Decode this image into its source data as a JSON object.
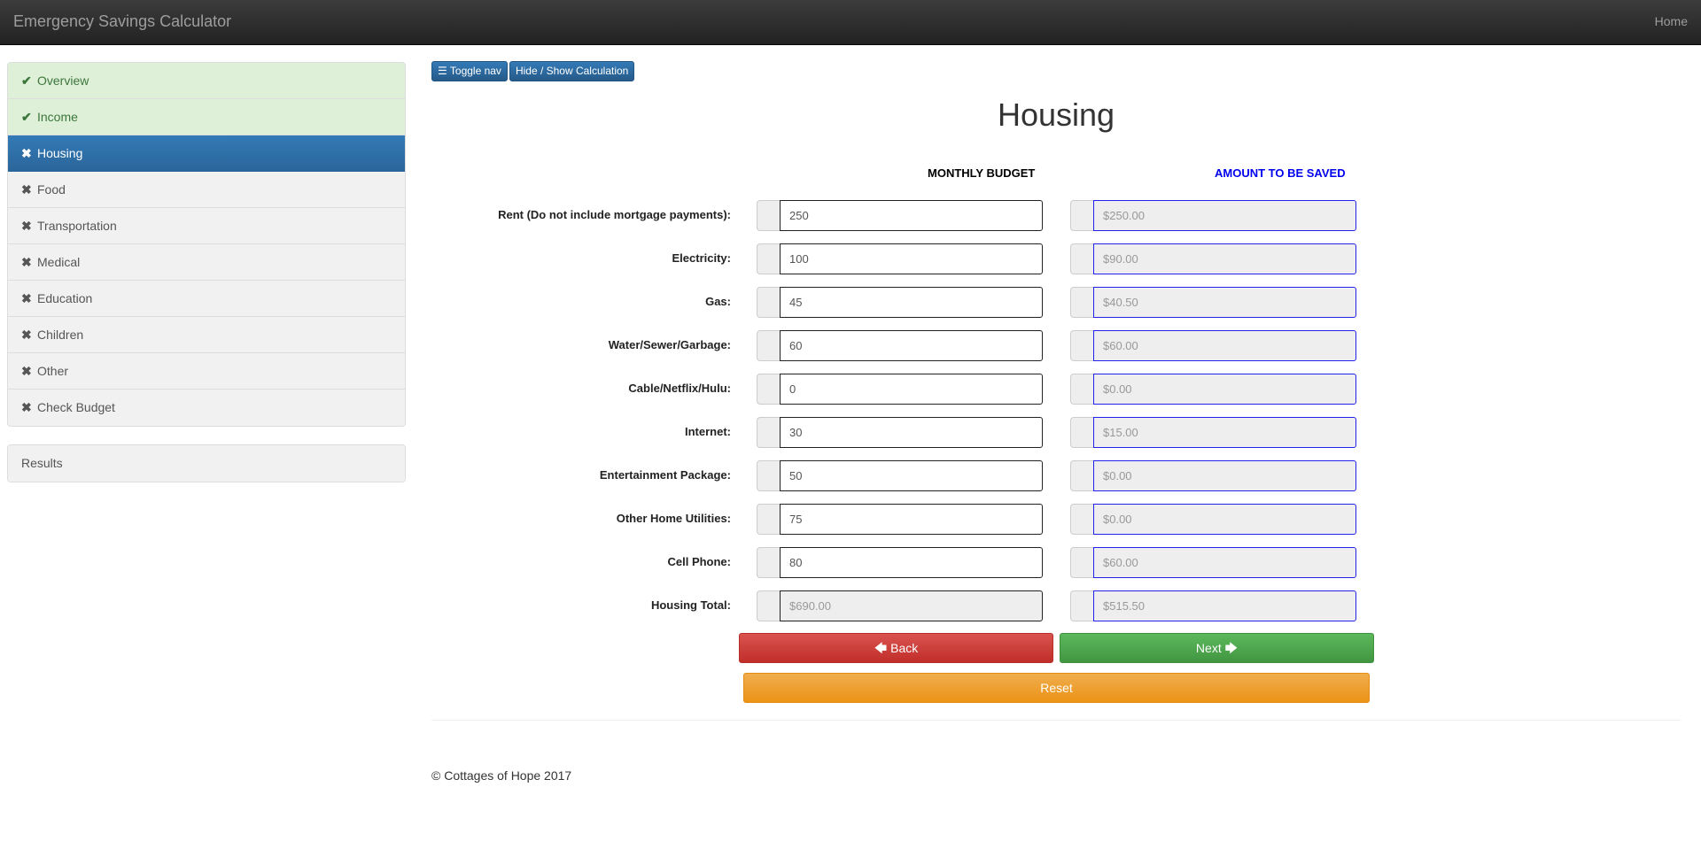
{
  "navbar": {
    "brand": "Emergency Savings Calculator",
    "home": "Home"
  },
  "sidebar": {
    "items": [
      {
        "label": "Overview",
        "mark": "✔",
        "state": "done"
      },
      {
        "label": "Income",
        "mark": "✔",
        "state": "done"
      },
      {
        "label": "Housing",
        "mark": "✖",
        "state": "active"
      },
      {
        "label": "Food",
        "mark": "✖",
        "state": "pending"
      },
      {
        "label": "Transportation",
        "mark": "✖",
        "state": "pending"
      },
      {
        "label": "Medical",
        "mark": "✖",
        "state": "pending"
      },
      {
        "label": "Education",
        "mark": "✖",
        "state": "pending"
      },
      {
        "label": "Children",
        "mark": "✖",
        "state": "pending"
      },
      {
        "label": "Other",
        "mark": "✖",
        "state": "pending"
      },
      {
        "label": "Check Budget",
        "mark": "✖",
        "state": "pending"
      }
    ],
    "results": "Results"
  },
  "toolbar": {
    "toggle_nav": "Toggle nav",
    "toggle_nav_icon": "☰",
    "hide_show": "Hide / Show Calculation"
  },
  "page": {
    "title": "Housing",
    "col_monthly": "MONTHLY BUDGET",
    "col_saved": "AMOUNT TO BE SAVED"
  },
  "rows": [
    {
      "label": "Rent (Do not include mortgage payments):",
      "monthly": "250",
      "saved": "$250.00"
    },
    {
      "label": "Electricity:",
      "monthly": "100",
      "saved": "$90.00"
    },
    {
      "label": "Gas:",
      "monthly": "45",
      "saved": "$40.50"
    },
    {
      "label": "Water/Sewer/Garbage:",
      "monthly": "60",
      "saved": "$60.00"
    },
    {
      "label": "Cable/Netflix/Hulu:",
      "monthly": "0",
      "saved": "$0.00"
    },
    {
      "label": "Internet:",
      "monthly": "30",
      "saved": "$15.00"
    },
    {
      "label": "Entertainment Package:",
      "monthly": "50",
      "saved": "$0.00"
    },
    {
      "label": "Other Home Utilities:",
      "monthly": "75",
      "saved": "$0.00"
    },
    {
      "label": "Cell Phone:",
      "monthly": "80",
      "saved": "$60.00"
    },
    {
      "label": "Housing Total:",
      "monthly": "$690.00",
      "saved": "$515.50"
    }
  ],
  "buttons": {
    "back": "Back",
    "back_icon": "🡄",
    "next": "Next",
    "next_icon": "🡆",
    "reset": "Reset"
  },
  "footer": {
    "text": "© Cottages of Hope 2017"
  },
  "colors": {
    "active": "#337ab7",
    "done_bg": "#dff0d8",
    "done_text": "#3c763d",
    "saved_header": "#0000ee",
    "back": "#d9534f",
    "next": "#5cb85c",
    "reset": "#f0ad4e"
  }
}
